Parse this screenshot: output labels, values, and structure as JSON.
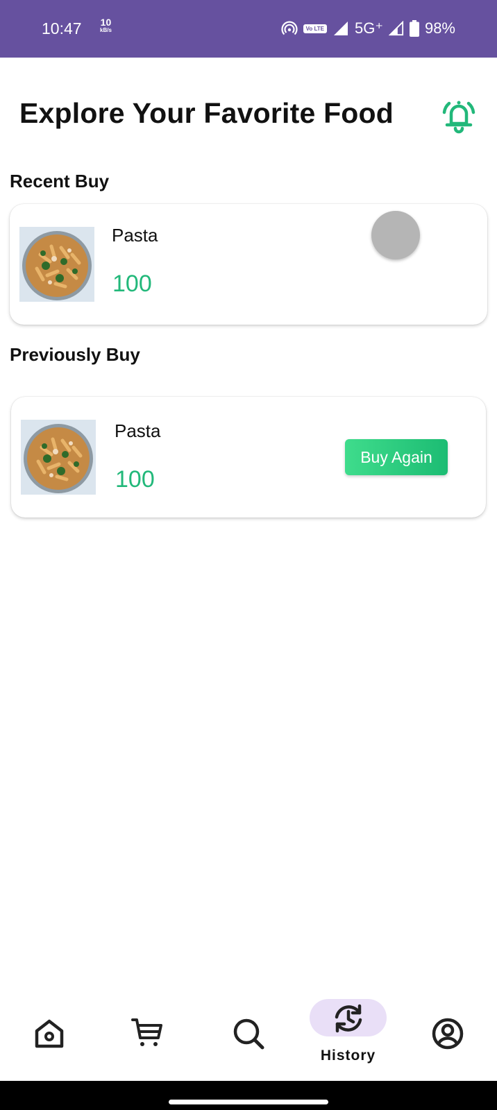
{
  "status_bar": {
    "time": "10:47",
    "speed_value": "10",
    "speed_unit": "kB/s",
    "volte": "Vo LTE",
    "network": "5G⁺",
    "battery": "98%"
  },
  "header": {
    "title": "Explore Your Favorite Food",
    "bell_icon": "bell-ringing-icon",
    "accent_color": "#22b87a"
  },
  "recent": {
    "section_title": "Recent Buy",
    "items": [
      {
        "name": "Pasta",
        "price": "100"
      }
    ]
  },
  "previous": {
    "section_title": "Previously Buy",
    "items": [
      {
        "name": "Pasta",
        "price": "100",
        "button_label": "Buy Again"
      }
    ]
  },
  "bottom_nav": {
    "items": [
      {
        "icon": "home-icon"
      },
      {
        "icon": "cart-icon"
      },
      {
        "icon": "search-icon"
      },
      {
        "icon": "history-icon",
        "label": "History",
        "active": true
      },
      {
        "icon": "profile-icon"
      }
    ]
  },
  "colors": {
    "status_bar": "#66519f",
    "price": "#22b87a",
    "nav_active_pill": "#e9dff7"
  }
}
